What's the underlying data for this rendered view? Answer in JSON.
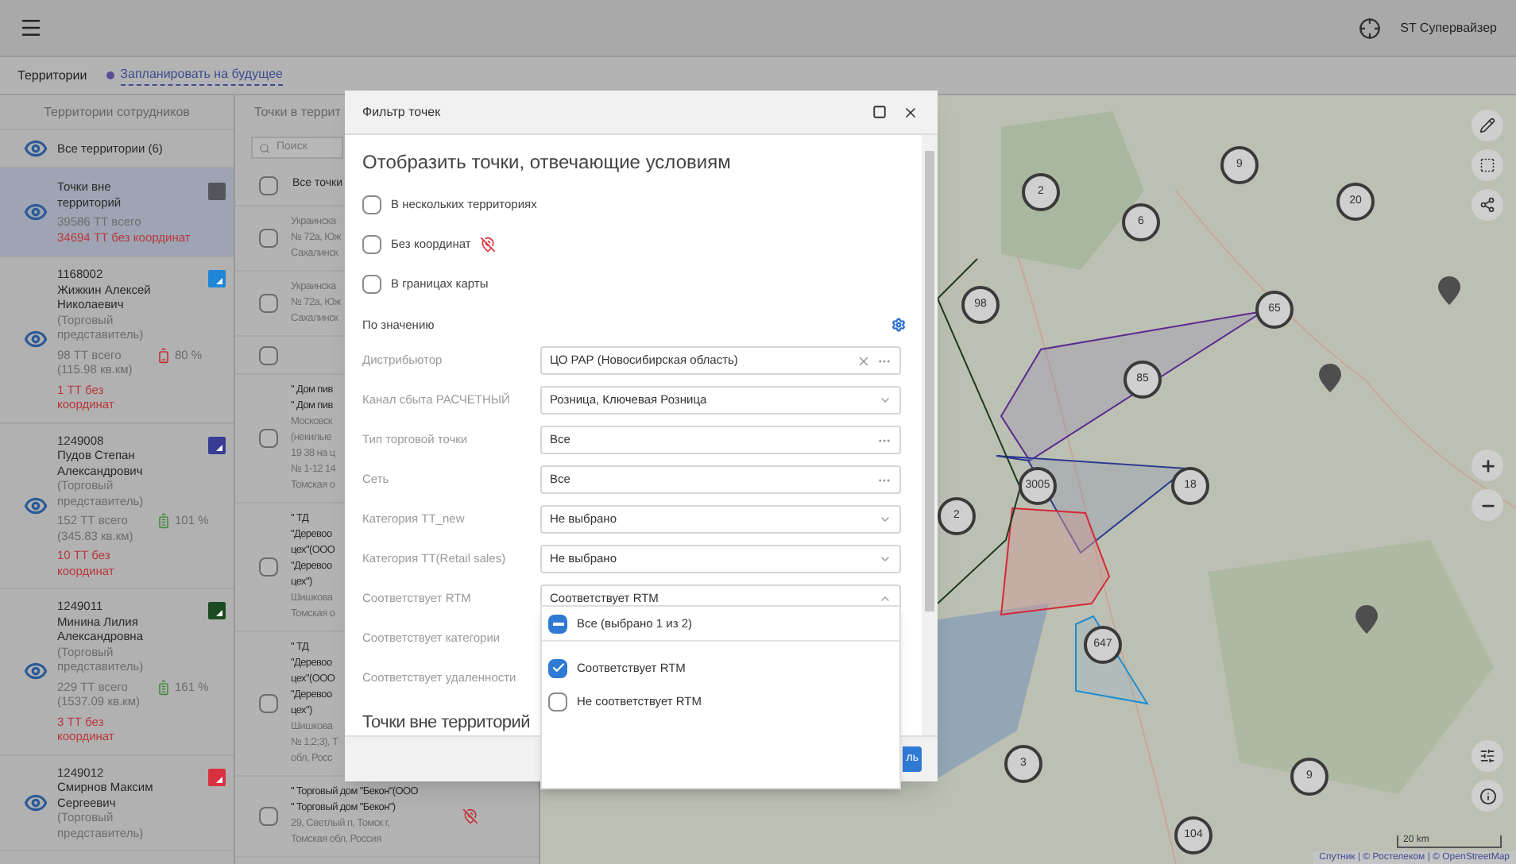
{
  "topbar": {
    "user": "ST Супервайзер"
  },
  "subbar": {
    "title": "Территории",
    "plan_link": "Запланировать на будущее"
  },
  "territories": {
    "title": "Территории сотрудников",
    "all_label": "Все территории (6)",
    "items": [
      {
        "kind": "outside",
        "name": "Точки вне территорий",
        "total": "39586 ТТ всего",
        "no_coords": "34694 ТТ без координат",
        "color": "#55565c",
        "selected": true
      },
      {
        "kind": "employee",
        "id": "1168002",
        "name": "Жижкин Алексей Николаевич",
        "role": "(Торговый представитель)",
        "total": "98 ТТ всего",
        "area": "(115.98 кв.км)",
        "battery": "80 %",
        "battery_low": true,
        "no_coords": "1 ТТ без координат",
        "color": "#1f86d8",
        "selected": false
      },
      {
        "kind": "employee",
        "id": "1249008",
        "name": "Пудов Степан Александрович",
        "role": "(Торговый представитель)",
        "total": "152 ТТ всего",
        "area": "(345.83 кв.км)",
        "battery": "101 %",
        "battery_low": false,
        "no_coords": "10 ТТ без координат",
        "color": "#3a3c94",
        "selected": false
      },
      {
        "kind": "employee",
        "id": "1249011",
        "name": "Минина Лилия Александровна",
        "role": "(Торговый представитель)",
        "total": "229 ТТ всего",
        "area": "(1537.09 кв.км)",
        "battery": "161 %",
        "battery_low": false,
        "no_coords": "3 ТТ без координат",
        "color": "#1c4a22",
        "selected": false
      },
      {
        "kind": "employee",
        "id": "1249012",
        "name": "Смирнов Максим Сергеевич",
        "role": "(Торговый представитель)",
        "color": "#d9313f",
        "selected": false
      }
    ]
  },
  "points": {
    "title": "Точки в террит",
    "search_placeholder": "Поиск",
    "rows": [
      {
        "kind": "all",
        "label": "Все точки",
        "checked": false
      },
      {
        "kind": "point",
        "name_lines": [],
        "address_lines": [
          "Украинска",
          "№ 72а, Юж",
          "Сахалинск"
        ],
        "checked": false
      },
      {
        "kind": "point",
        "name_lines": [],
        "address_lines": [
          "Украинска",
          "№ 72а, Юж",
          "Сахалинск"
        ],
        "checked": false
      },
      {
        "kind": "point",
        "name_lines": [],
        "address_lines": [],
        "checked": false
      },
      {
        "kind": "point",
        "name_lines": [
          "\" Дом пив",
          "\" Дом пив"
        ],
        "address_lines": [
          "Московск",
          "(некилые",
          "19 38 на ц",
          "№ 1-12 14",
          "Томская о"
        ],
        "checked": false
      },
      {
        "kind": "point",
        "name_lines": [
          "\" ТД",
          "\"Деревоо",
          "цех\"(ООО",
          "\"Деревоо",
          "цех\")"
        ],
        "address_lines": [
          "Шишкова",
          "Томская о"
        ],
        "checked": false
      },
      {
        "kind": "point",
        "name_lines": [
          "\" ТД",
          "\"Деревоо",
          "цех\"(ООО",
          "\"Деревоо",
          "цех\")"
        ],
        "address_lines": [
          "Шишкова",
          "№ 1;2;3), Т",
          "обл, Росс"
        ],
        "checked": false
      },
      {
        "kind": "point",
        "name_lines": [
          "\" Торговый дом \"Бекон\"(ООО",
          "\" Торговый дом \"Бекон\")"
        ],
        "address_lines": [
          "29, Светлый п, Томск г,",
          "Томская обл, Россия"
        ],
        "no_coords": true,
        "checked": false
      }
    ]
  },
  "filter_dialog": {
    "title": "Фильтр точек",
    "heading": "Отобразить точки, отвечающие условиям",
    "flags": [
      {
        "label": "В нескольких территориях",
        "checked": false,
        "no_coords_icon": false
      },
      {
        "label": "Без координат",
        "checked": false,
        "no_coords_icon": true
      },
      {
        "label": "В границах карты",
        "checked": false,
        "no_coords_icon": false
      }
    ],
    "section_label": "По значению",
    "fields": [
      {
        "label": "Дистрибьютор",
        "value": "ЦО РАР (Новосибирская область)",
        "kind": "clearable"
      },
      {
        "label": "Канал сбыта РАСЧЕТНЫЙ",
        "value": "Розница, Ключевая Розница",
        "kind": "select",
        "expanded": false
      },
      {
        "label": "Тип торговой точки",
        "value": "Все",
        "kind": "picker"
      },
      {
        "label": "Сеть",
        "value": "Все",
        "kind": "picker"
      },
      {
        "label": "Категория ТТ_new",
        "value": "Не выбрано",
        "kind": "select",
        "expanded": false
      },
      {
        "label": "Категория ТТ(Retail sales)",
        "value": "Не выбрано",
        "kind": "select",
        "expanded": false
      },
      {
        "label": "Соответствует RTM",
        "value": "Соответствует RTM",
        "kind": "select",
        "expanded": true
      },
      {
        "label": "Соответствует категории",
        "kind": "covered"
      },
      {
        "label": "Соответствует удаленности",
        "kind": "covered"
      }
    ],
    "second_heading": "Точки вне территорий",
    "apply_button": "ль",
    "dropdown": {
      "all": {
        "label": "Все (выбрано 1 из 2)",
        "indeterminate": true
      },
      "options": [
        {
          "label": "Соответствует RTM",
          "checked": true
        },
        {
          "label": "Не соответствует RTM",
          "checked": false
        }
      ]
    }
  },
  "map": {
    "clusters": [
      "9",
      "2",
      "20",
      "6",
      "98",
      "65",
      "85",
      "18",
      "3005",
      "647",
      "3",
      "9",
      "104",
      "2"
    ],
    "scale": "20 km",
    "attribution": "Спутник | © Ростелеком | © OpenStreetMap"
  }
}
